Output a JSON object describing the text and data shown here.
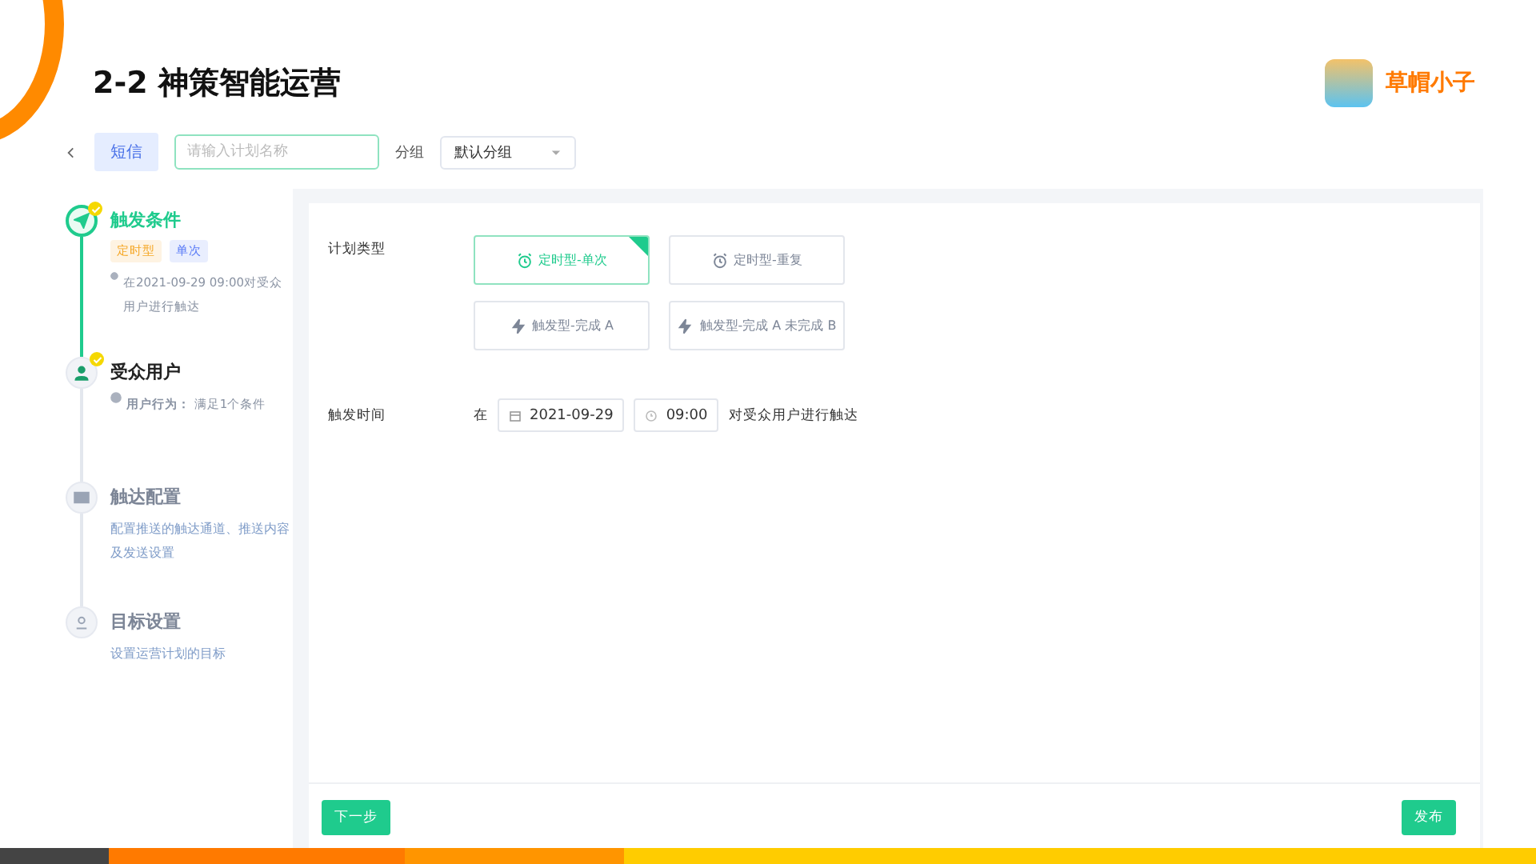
{
  "slide": {
    "title": "2-2 神策智能运营",
    "brand": "草帽小子"
  },
  "toolbar": {
    "channel_tab": "短信",
    "name_field": {
      "placeholder": "请输入计划名称"
    },
    "group_label": "分组",
    "group_select": "默认分组"
  },
  "steps": [
    {
      "kind": "send",
      "title": "触发条件",
      "current": true,
      "completed": true,
      "tags": [
        {
          "label": "定时型",
          "color": "#f5a623"
        },
        {
          "label": "单次",
          "color": "#5b7cf7"
        }
      ],
      "note": "在2021-09-29 09:00对受众用户进行触达"
    },
    {
      "kind": "user",
      "title": "受众用户",
      "current": false,
      "completed": true,
      "note": "**用户行为：** 满足1个条件"
    },
    {
      "kind": "mail",
      "title": "触达配置",
      "current": false,
      "completed": false,
      "desc": "配置推送的触达通道、推送内容及发送设置"
    },
    {
      "kind": "target",
      "title": "目标设置",
      "current": false,
      "completed": false,
      "desc": "设置运营计划的目标"
    }
  ],
  "form": {
    "plan_type": {
      "label": "计划类型",
      "options": [
        {
          "kind": "clock",
          "label": "定时型-单次",
          "selected": true
        },
        {
          "kind": "clock",
          "label": "定时型-重复",
          "selected": false
        },
        {
          "kind": "bolt",
          "label": "触发型-完成 A",
          "selected": false
        },
        {
          "kind": "bolt",
          "label": "触发型-完成 A 未完成 B",
          "selected": false
        }
      ]
    },
    "trigger_time": {
      "label": "触发时间",
      "prefix": "在",
      "date": "2021-09-29",
      "time": "09:00",
      "suffix": "对受众用户进行触达"
    }
  },
  "actions": {
    "next": "下一步",
    "publish": "发布"
  }
}
